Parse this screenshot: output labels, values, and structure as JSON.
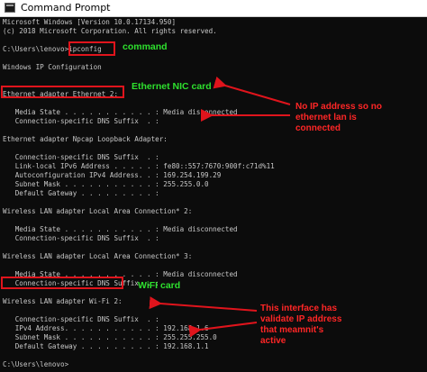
{
  "window": {
    "title": "Command Prompt",
    "icon": "cmd-icon"
  },
  "console": {
    "lines": [
      "Microsoft Windows [Version 10.0.17134.950]",
      "(c) 2018 Microsoft Corporation. All rights reserved.",
      "",
      "C:\\Users\\lenovo>ipconfig",
      "",
      "Windows IP Configuration",
      "",
      "",
      "Ethernet adapter Ethernet 2:",
      "",
      "   Media State . . . . . . . . . . . : Media disconnected",
      "   Connection-specific DNS Suffix  . :",
      "",
      "Ethernet adapter Npcap Loopback Adapter:",
      "",
      "   Connection-specific DNS Suffix  . :",
      "   Link-local IPv6 Address . . . . . : fe80::557:7670:900f:c71d%11",
      "   Autoconfiguration IPv4 Address. . : 169.254.199.29",
      "   Subnet Mask . . . . . . . . . . . : 255.255.0.0",
      "   Default Gateway . . . . . . . . . :",
      "",
      "Wireless LAN adapter Local Area Connection* 2:",
      "",
      "   Media State . . . . . . . . . . . : Media disconnected",
      "   Connection-specific DNS Suffix  . :",
      "",
      "Wireless LAN adapter Local Area Connection* 3:",
      "",
      "   Media State . . . . . . . . . . . : Media disconnected",
      "   Connection-specific DNS Suffix  . :",
      "",
      "Wireless LAN adapter Wi-Fi 2:",
      "",
      "   Connection-specific DNS Suffix  . :",
      "   IPv4 Address. . . . . . . . . . . : 192.168.1.6",
      "   Subnet Mask . . . . . . . . . . . : 255.255.255.0",
      "   Default Gateway . . . . . . . . . : 192.168.1.1",
      "",
      "C:\\Users\\lenovo>"
    ]
  },
  "annotations": {
    "command": "command",
    "ethernet_nic": "Ethernet NIC card",
    "no_ip": [
      "No IP address so no",
      "ethernet lan is",
      "connected"
    ],
    "wifi": "WiFI card",
    "valid_ip": [
      "This interface has",
      "validate IP address",
      "that meamnit's",
      "active"
    ]
  },
  "colors": {
    "console_bg": "#0c0c0c",
    "console_text": "#c8c8c8",
    "highlight_box": "#e0141c",
    "green_note": "#2ee02e",
    "red_note": "#ff2626"
  }
}
